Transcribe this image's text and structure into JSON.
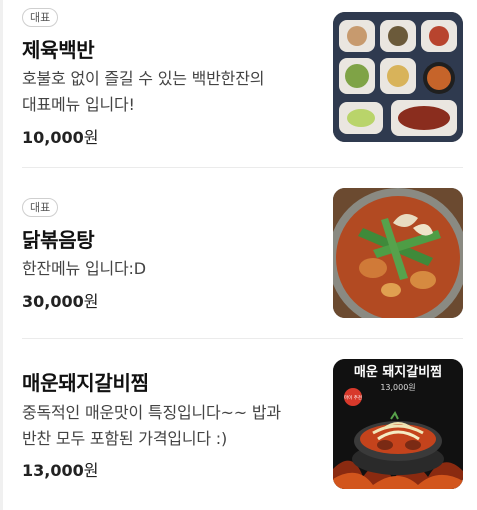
{
  "menu": [
    {
      "badge": "대표",
      "name": "제육백반",
      "desc_line1": "호불호 없이 즐길 수 있는 백반한잔의",
      "desc_line2": "대표메뉴 입니다!",
      "price": "10,000",
      "currency": "원"
    },
    {
      "badge": "대표",
      "name": "닭볶음탕",
      "desc_line1": "한잔메뉴 입니다:D",
      "price": "30,000",
      "currency": "원"
    },
    {
      "name": "매운돼지갈비찜",
      "desc_line1": "중독적인 매운맛이 특징입니다~~ 밥과",
      "desc_line2": "반찬 모두 포함된 가격입니다 :)",
      "price": "13,000",
      "currency": "원",
      "image_title": "매운 돼지갈비찜",
      "image_price": "13,000원",
      "image_stamp": "마이 추천"
    }
  ]
}
